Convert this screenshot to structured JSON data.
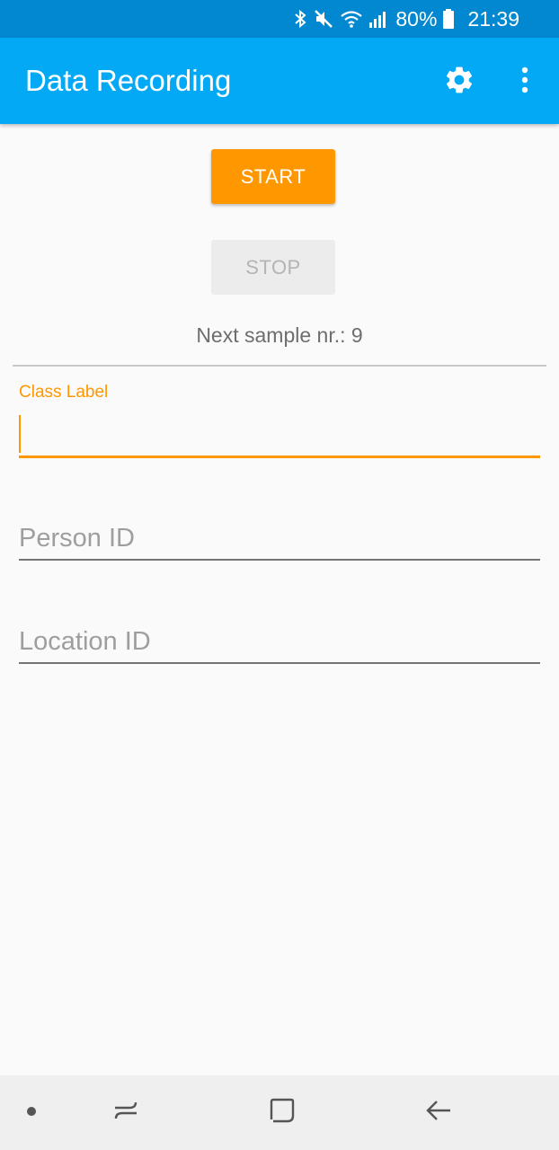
{
  "status_bar": {
    "battery_percent": "80%",
    "time": "21:39",
    "icons": [
      "bluetooth-icon",
      "mute-icon",
      "wifi-icon",
      "signal-icon",
      "battery-icon"
    ]
  },
  "app_bar": {
    "title": "Data Recording",
    "icons": [
      "settings-icon",
      "more-vert-icon"
    ]
  },
  "controls": {
    "start_label": "START",
    "stop_label": "STOP",
    "next_sample_text": "Next sample nr.: 9"
  },
  "form": {
    "class_label": {
      "label": "Class Label",
      "value": ""
    },
    "person_id": {
      "placeholder": "Person ID",
      "value": ""
    },
    "location_id": {
      "placeholder": "Location ID",
      "value": ""
    }
  },
  "nav_bar": {
    "icons": [
      "dot-icon",
      "recents-icon",
      "home-icon",
      "back-icon"
    ]
  },
  "colors": {
    "status_bar": "#0288d1",
    "app_bar": "#03a9f4",
    "accent": "#ff9800",
    "background": "#fafafa"
  }
}
